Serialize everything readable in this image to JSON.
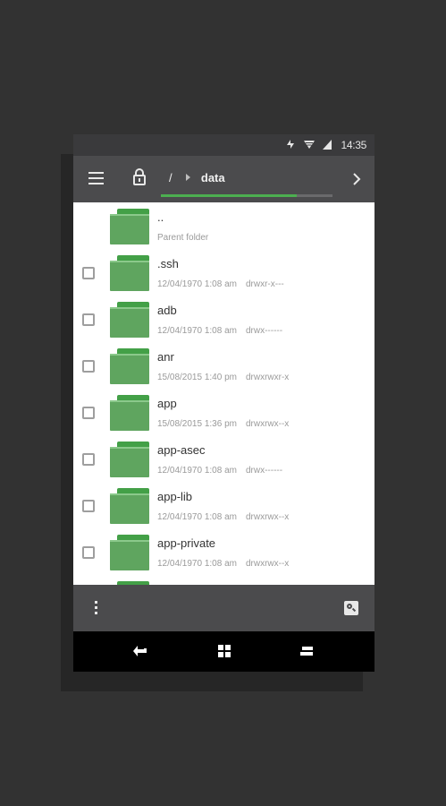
{
  "status": {
    "time": "14:35",
    "icons": [
      "data-transfer-icon",
      "wifi-icon",
      "signal-icon"
    ]
  },
  "toolbar": {
    "root": "/",
    "current": "data",
    "progress": 0.79
  },
  "files": [
    {
      "name": "..",
      "date": "Parent folder",
      "perm": "",
      "parent": true
    },
    {
      "name": ".ssh",
      "date": "12/04/1970 1:08 am",
      "perm": "drwxr-x---"
    },
    {
      "name": "adb",
      "date": "12/04/1970 1:08 am",
      "perm": "drwx------"
    },
    {
      "name": "anr",
      "date": "15/08/2015 1:40 pm",
      "perm": "drwxrwxr-x"
    },
    {
      "name": "app",
      "date": "15/08/2015 1:36 pm",
      "perm": "drwxrwx--x"
    },
    {
      "name": "app-asec",
      "date": "12/04/1970 1:08 am",
      "perm": "drwx------"
    },
    {
      "name": "app-lib",
      "date": "12/04/1970 1:08 am",
      "perm": "drwxrwx--x"
    },
    {
      "name": "app-private",
      "date": "12/04/1970 1:08 am",
      "perm": "drwxrwx--x"
    }
  ],
  "colors": {
    "accent": "#4caf50",
    "folder": "#5fa55f",
    "toolbar": "#4b4b4d"
  }
}
